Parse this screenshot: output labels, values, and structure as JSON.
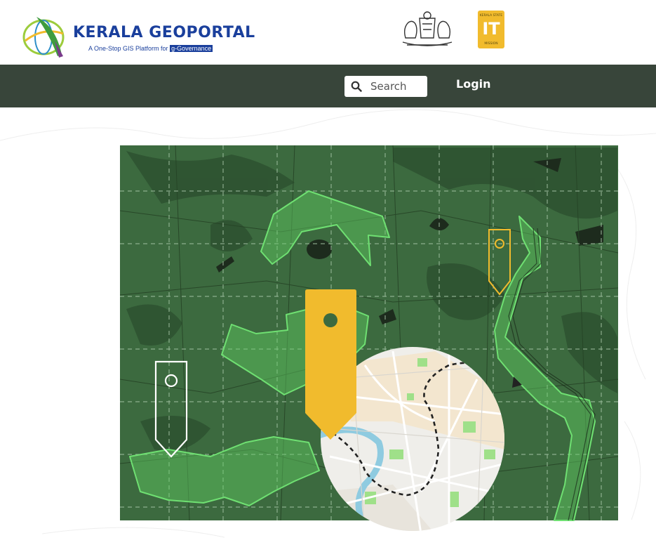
{
  "header": {
    "logo_title": "KERALA GEOPORTAL",
    "logo_tagline": "A One-Stop GIS Platform for",
    "logo_tagline_highlight": "g-Governance",
    "it_logo_top": "KERALA STATE",
    "it_logo_mid": "IT",
    "it_logo_bottom": "MISSION"
  },
  "navbar": {
    "search_placeholder": "Search",
    "login_label": "Login"
  },
  "colors": {
    "navbar_bg": "#38453a",
    "brand_blue": "#1a3f9c",
    "map_green": "#3c6a3f",
    "polygon_green": "#5fcf62",
    "pin_yellow": "#f1bb2d"
  },
  "icons": [
    "search-icon",
    "kerala-geoportal-logo",
    "kerala-emblem",
    "kerala-it-mission-logo",
    "map-pin-icon"
  ]
}
